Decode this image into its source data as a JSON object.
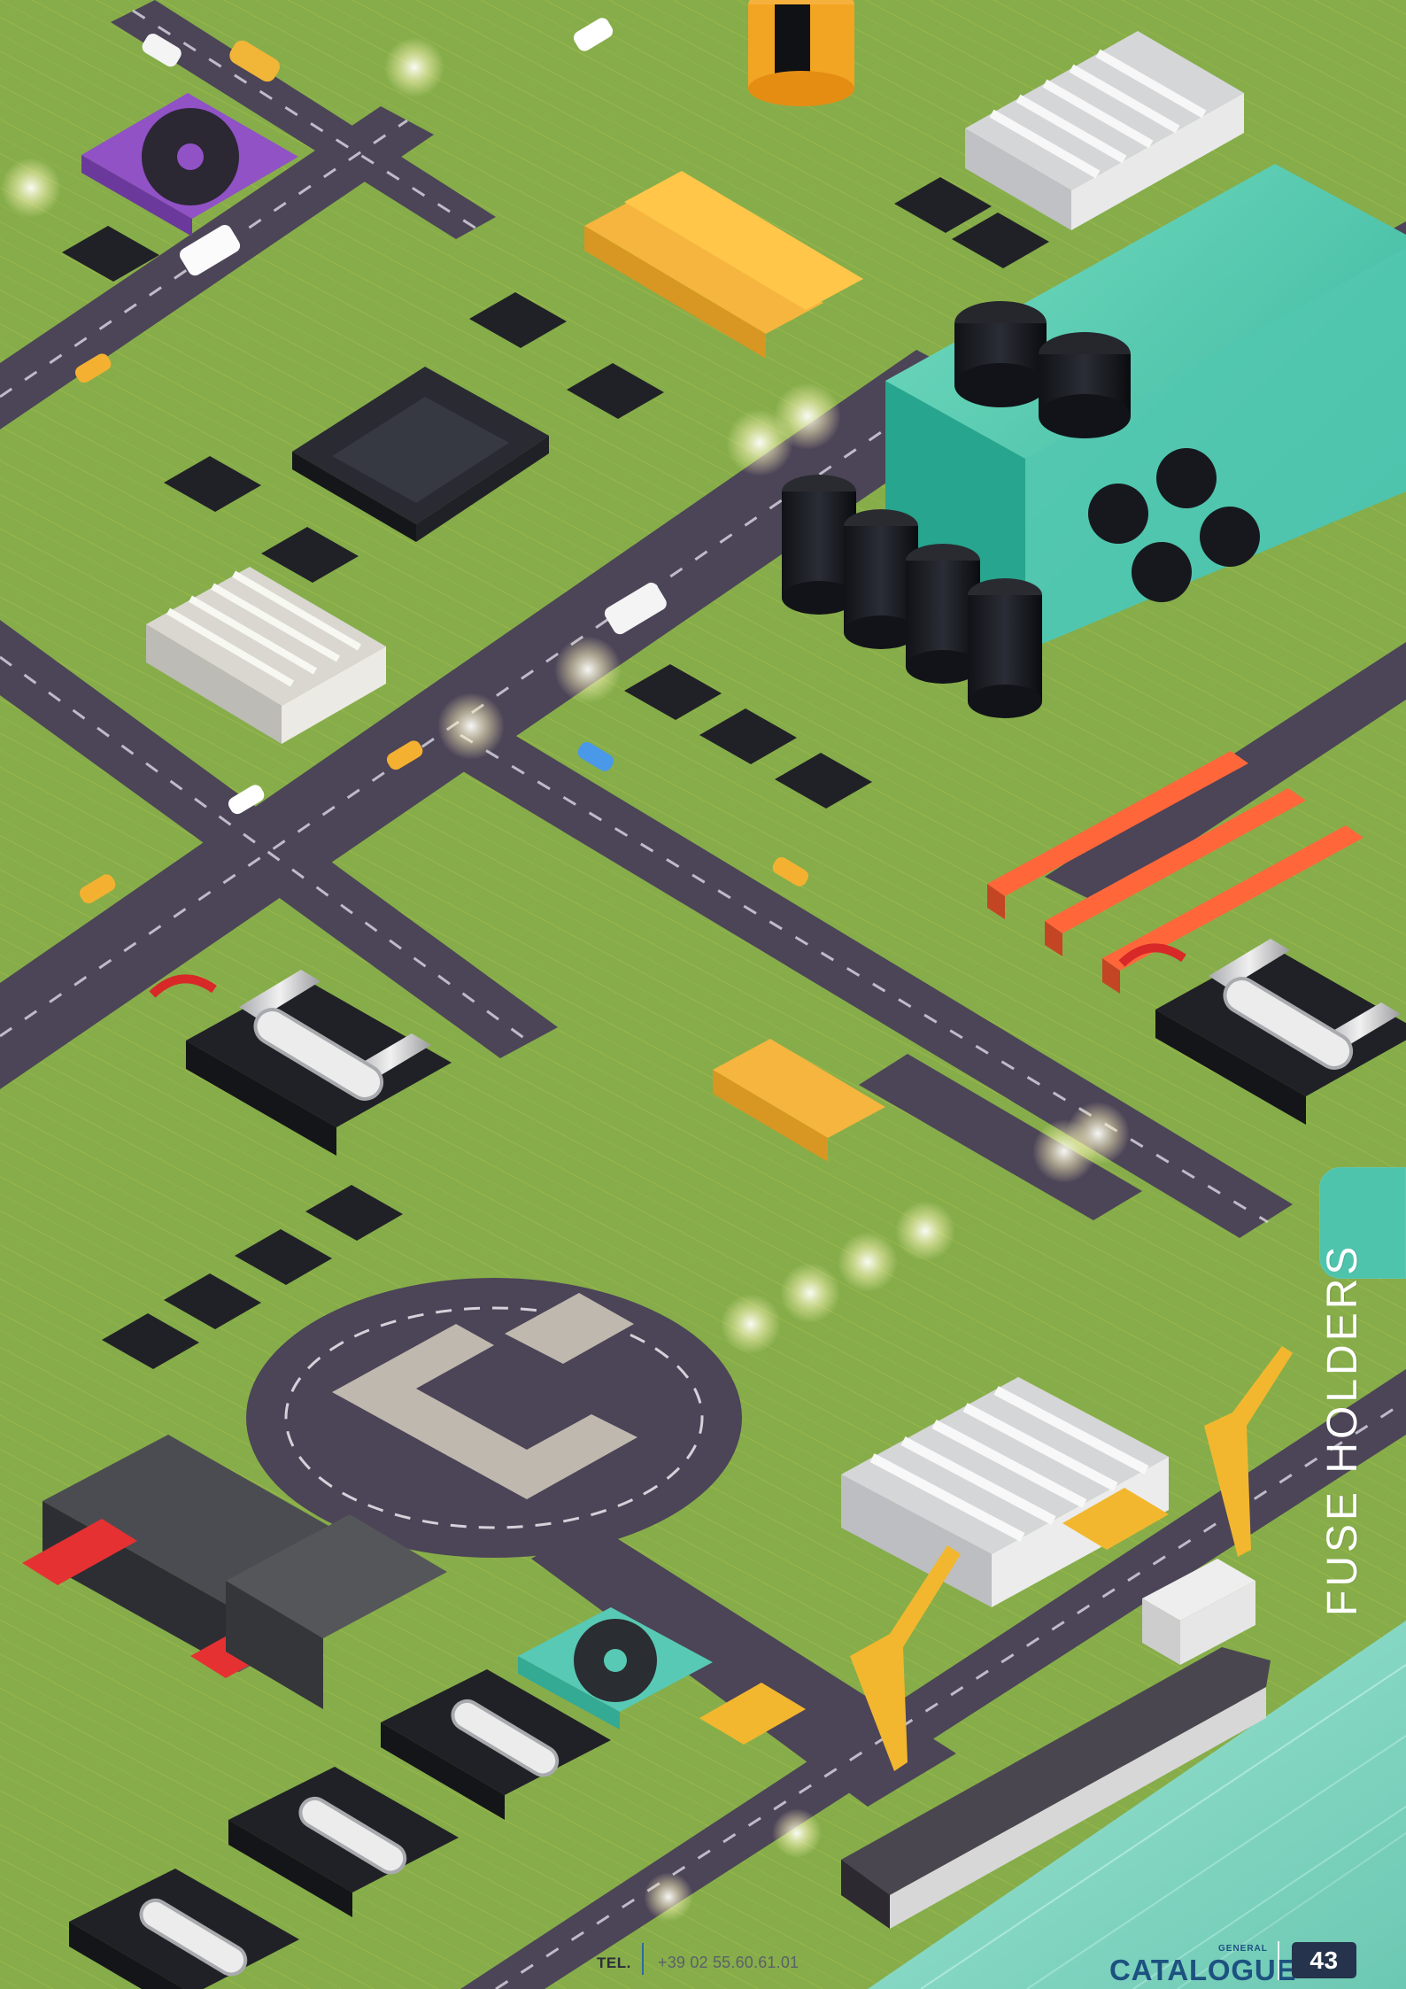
{
  "side_tab": {
    "title": "FUSE HOLDERS",
    "accent_color": "#4fc4ad"
  },
  "footer": {
    "tel_label": "TEL.",
    "tel_value": "+39 02 55.60.61.01",
    "catalogue_small": "GENERAL",
    "catalogue_label": "CATALOGUE",
    "page_number": "43"
  },
  "colors": {
    "board": "#86ad4a",
    "road": "#4c4457",
    "sea": "#7ad7c1",
    "brand_blue": "#1d5280",
    "page_badge": "#25344c"
  }
}
